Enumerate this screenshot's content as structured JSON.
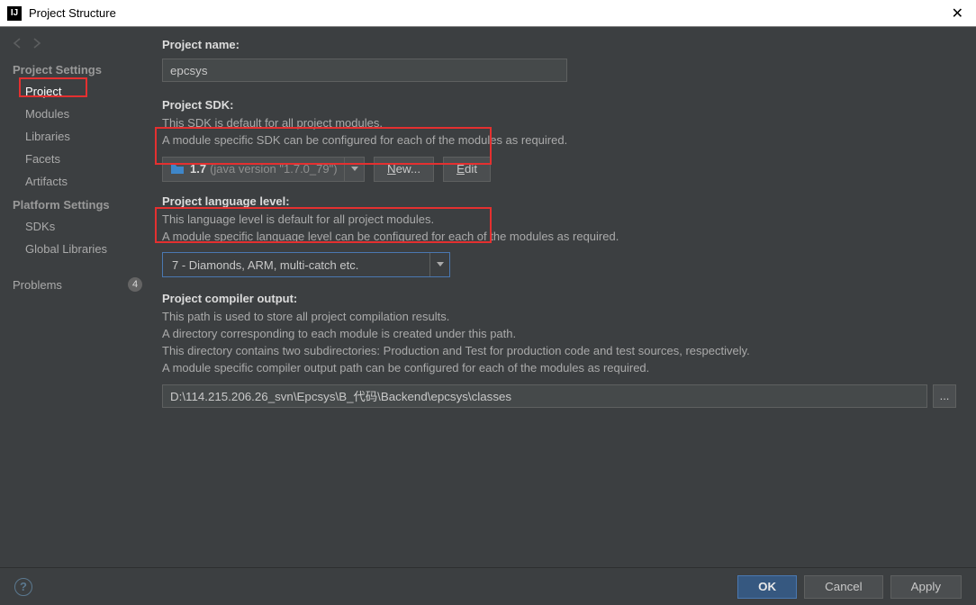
{
  "window": {
    "title": "Project Structure"
  },
  "sidebar": {
    "nav_back": "←",
    "nav_fwd": "→",
    "section1": "Project Settings",
    "items1": [
      "Project",
      "Modules",
      "Libraries",
      "Facets",
      "Artifacts"
    ],
    "section2": "Platform Settings",
    "items2": [
      "SDKs",
      "Global Libraries"
    ],
    "problems_label": "Problems",
    "problems_count": "4"
  },
  "project": {
    "name_label": "Project name:",
    "name_value": "epcsys",
    "sdk_label": "Project SDK:",
    "sdk_desc1": "This SDK is default for all project modules.",
    "sdk_desc2": "A module specific SDK can be configured for each of the modules as required.",
    "sdk_name": "1.7",
    "sdk_version": "(java version \"1.7.0_79\")",
    "new_prefix": "N",
    "new_rest": "ew...",
    "edit_prefix": "E",
    "edit_rest": "dit",
    "lang_label": "Project language level:",
    "lang_desc1": "This language level is default for all project modules.",
    "lang_desc2": "A module specific language level can be configured for each of the modules as required.",
    "lang_value": "7 - Diamonds, ARM, multi-catch etc.",
    "compiler_label": "Project compiler output:",
    "compiler_desc1": "This path is used to store all project compilation results.",
    "compiler_desc2": "A directory corresponding to each module is created under this path.",
    "compiler_desc3": "This directory contains two subdirectories: Production and Test for production code and test sources, respectively.",
    "compiler_desc4": "A module specific compiler output path can be configured for each of the modules as required.",
    "compiler_path": "D:\\114.215.206.26_svn\\Epcsys\\B_代码\\Backend\\epcsys\\classes",
    "browse": "..."
  },
  "footer": {
    "ok": "OK",
    "cancel": "Cancel",
    "apply": "Apply"
  }
}
